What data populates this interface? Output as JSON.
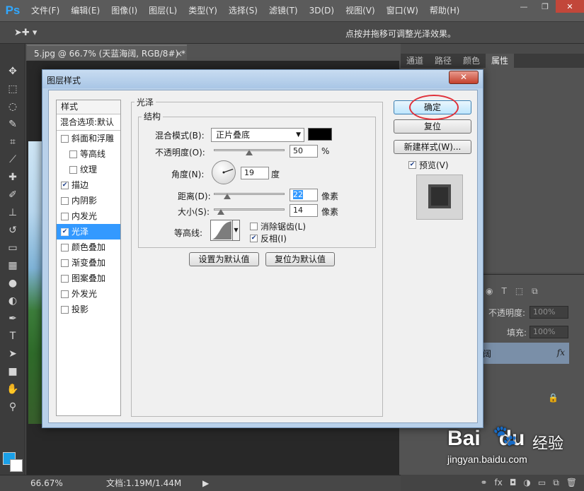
{
  "app": {
    "logo": "Ps",
    "menu": [
      "文件(F)",
      "编辑(E)",
      "图像(I)",
      "图层(L)",
      "类型(Y)",
      "选择(S)",
      "滤镜(T)",
      "3D(D)",
      "视图(V)",
      "窗口(W)",
      "帮助(H)"
    ],
    "window_controls": {
      "minimize": "—",
      "restore": "❐",
      "close": "✕"
    }
  },
  "options_bar": {
    "tool_icon": "move-tool-icon",
    "hint": "点按并拖移可调整光泽效果。"
  },
  "document_tab": {
    "title": "5.jpg @ 66.7% (天蓝海阔, RGB/8#) *",
    "close": "×"
  },
  "panels": {
    "tabs": [
      "通道",
      "路径",
      "颜色",
      "属性"
    ],
    "active_tab": "属性",
    "layers": {
      "opacity_label": "不透明度:",
      "opacity_value": "100%",
      "fill_label": "填充:",
      "fill_value": "100%",
      "layer_name": "阔",
      "fx": "fx"
    }
  },
  "status": {
    "zoom": "66.67%",
    "doc": "文档:1.19M/1.44M"
  },
  "watermark": {
    "logo": "Bai",
    "logo_suffix": "du",
    "sub": "经验",
    "url": "jingyan.baidu.com"
  },
  "dialog": {
    "title": "图层样式",
    "close": "✕",
    "style_list": {
      "header": "样式",
      "blend_options": "混合选项:默认",
      "items": [
        {
          "label": "斜面和浮雕",
          "checked": false,
          "indent": false,
          "selected": false
        },
        {
          "label": "等高线",
          "checked": false,
          "indent": true,
          "selected": false
        },
        {
          "label": "纹理",
          "checked": false,
          "indent": true,
          "selected": false
        },
        {
          "label": "描边",
          "checked": true,
          "indent": false,
          "selected": false
        },
        {
          "label": "内阴影",
          "checked": false,
          "indent": false,
          "selected": false
        },
        {
          "label": "内发光",
          "checked": false,
          "indent": false,
          "selected": false
        },
        {
          "label": "光泽",
          "checked": true,
          "indent": false,
          "selected": true
        },
        {
          "label": "颜色叠加",
          "checked": false,
          "indent": false,
          "selected": false
        },
        {
          "label": "渐变叠加",
          "checked": false,
          "indent": false,
          "selected": false
        },
        {
          "label": "图案叠加",
          "checked": false,
          "indent": false,
          "selected": false
        },
        {
          "label": "外发光",
          "checked": false,
          "indent": false,
          "selected": false
        },
        {
          "label": "投影",
          "checked": false,
          "indent": false,
          "selected": false
        }
      ]
    },
    "satin": {
      "group_title": "光泽",
      "structure_title": "结构",
      "blend_mode_label": "混合模式(B):",
      "blend_mode_value": "正片叠底",
      "color": "#000000",
      "opacity_label": "不透明度(O):",
      "opacity_value": "50",
      "opacity_unit": "%",
      "angle_label": "角度(N):",
      "angle_value": "19",
      "angle_unit": "度",
      "distance_label": "距离(D):",
      "distance_value": "22",
      "distance_unit": "像素",
      "size_label": "大小(S):",
      "size_value": "14",
      "size_unit": "像素",
      "contour_label": "等高线:",
      "anti_alias_label": "消除锯齿(L)",
      "anti_alias_checked": false,
      "invert_label": "反相(I)",
      "invert_checked": true,
      "make_default": "设置为默认值",
      "reset_default": "复位为默认值"
    },
    "buttons": {
      "ok": "确定",
      "reset": "复位",
      "new_style": "新建样式(W)...",
      "preview_label": "预览(V)",
      "preview_checked": true
    }
  }
}
